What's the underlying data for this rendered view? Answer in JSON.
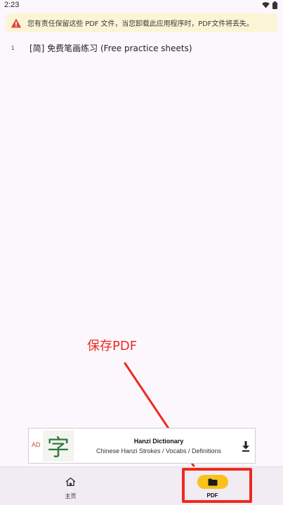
{
  "status_bar": {
    "time": "2:23",
    "icons": [
      "wifi-icon",
      "battery-icon"
    ]
  },
  "warning": {
    "icon": "warning-icon",
    "text": "您有责任保留这些 PDF 文件，当您卸载此应用程序时，PDF文件将丢失。",
    "color": "#e0453a"
  },
  "files": [
    {
      "index": "1",
      "name": "[简] 免费笔画练习 (Free practice sheets)"
    }
  ],
  "annotation": {
    "caption": "保存PDF",
    "color": "#ec2a20"
  },
  "ad": {
    "label": "AD",
    "image_char": "字",
    "title": "Hanzi Dictionary",
    "subtitle": "Chinese Hanzi Strokes / Vocabs / Definitions",
    "action_icon": "download-icon"
  },
  "bottom_nav": {
    "items": [
      {
        "label": "主页",
        "icon": "home-icon",
        "selected": false
      },
      {
        "label": "PDF",
        "icon": "folder-icon",
        "selected": true
      }
    ],
    "selected_color": "#f7c21b"
  }
}
